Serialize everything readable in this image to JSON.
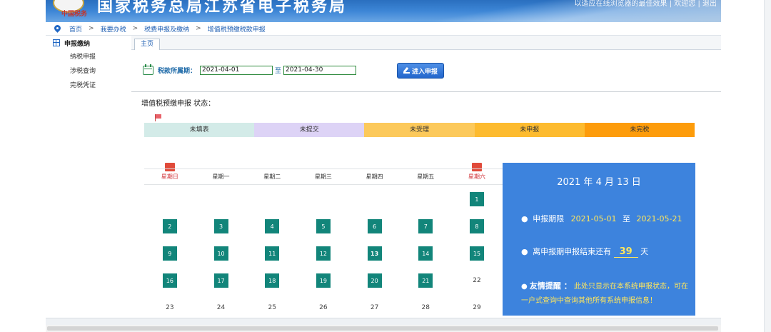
{
  "banner": {
    "emblem_text": "中国税务",
    "site_title": "国家税务总局江苏省电子税务局",
    "top_links": "以适应在线浏览器的最佳效果 | 欢迎您 | 退出"
  },
  "breadcrumb": {
    "items": [
      "首页",
      "我要办税",
      "税费申报及缴纳",
      "增值税预缴税款申报"
    ],
    "separator": ">"
  },
  "sidebar": {
    "section": "申报缴纳",
    "items": [
      "纳税申报",
      "涉税查询",
      "完税凭证"
    ]
  },
  "tabs": [
    "主页"
  ],
  "period": {
    "label": "税款所属期：",
    "start": "2021-04-01",
    "to": "至",
    "end": "2021-04-30",
    "button": "进入申报"
  },
  "status": {
    "title": "增值税预缴申报 状态：",
    "legend": [
      {
        "label": "未填表",
        "color": "#d3ebe8"
      },
      {
        "label": "未提交",
        "color": "#ddd3f6"
      },
      {
        "label": "未受理",
        "color": "#fcc95b"
      },
      {
        "label": "未申报",
        "color": "#fdbb2f"
      },
      {
        "label": "未完税",
        "color": "#fd9c0b"
      }
    ]
  },
  "calendar": {
    "weekdays": [
      "星期日",
      "星期一",
      "星期二",
      "星期三",
      "星期四",
      "星期五",
      "星期六"
    ],
    "weeks": [
      [
        null,
        null,
        null,
        null,
        null,
        null,
        {
          "day": "1",
          "marked": true
        }
      ],
      [
        {
          "day": "2",
          "marked": true
        },
        {
          "day": "3",
          "marked": true
        },
        {
          "day": "4",
          "marked": true
        },
        {
          "day": "5",
          "marked": true
        },
        {
          "day": "6",
          "marked": true
        },
        {
          "day": "7",
          "marked": true
        },
        {
          "day": "8",
          "marked": true
        }
      ],
      [
        {
          "day": "9",
          "marked": true
        },
        {
          "day": "10",
          "marked": true
        },
        {
          "day": "11",
          "marked": true
        },
        {
          "day": "12",
          "marked": true
        },
        {
          "day": "13",
          "marked": true,
          "today": true
        },
        {
          "day": "14",
          "marked": true
        },
        {
          "day": "15",
          "marked": true
        }
      ],
      [
        {
          "day": "16",
          "marked": true
        },
        {
          "day": "17",
          "marked": true
        },
        {
          "day": "18",
          "marked": true
        },
        {
          "day": "19",
          "marked": true
        },
        {
          "day": "20",
          "marked": true
        },
        {
          "day": "21",
          "marked": true
        },
        {
          "day": "22",
          "marked": false
        }
      ],
      [
        {
          "day": "23",
          "marked": false
        },
        {
          "day": "24",
          "marked": false
        },
        {
          "day": "25",
          "marked": false
        },
        {
          "day": "26",
          "marked": false
        },
        {
          "day": "27",
          "marked": false
        },
        {
          "day": "28",
          "marked": false
        },
        {
          "day": "29",
          "marked": false
        }
      ]
    ]
  },
  "info": {
    "date": "2021 年 4 月 13 日",
    "deadline_label": "申报期限",
    "deadline_start": "2021-05-01",
    "deadline_to": "至",
    "deadline_end": "2021-05-21",
    "remaining_prefix": "离申报期申报结束还有",
    "remaining_days": "39",
    "remaining_suffix": "天",
    "tip_label": "友情提醒 ：",
    "tip_text": "此处只显示在本系统申报状态，可在一户式查询中查询其他所有系统申报信息！",
    "bullet": "●"
  }
}
